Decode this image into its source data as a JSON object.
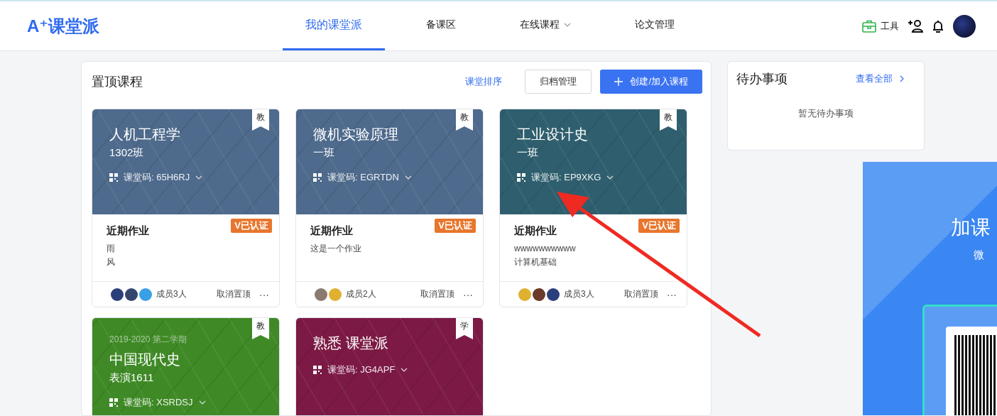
{
  "header": {
    "logo": "A⁺课堂派",
    "nav": [
      {
        "label": "我的课堂派",
        "selected": true,
        "dropdown": false
      },
      {
        "label": "备课区",
        "selected": false,
        "dropdown": false
      },
      {
        "label": "在线课程",
        "selected": false,
        "dropdown": true
      },
      {
        "label": "论文管理",
        "selected": false,
        "dropdown": false
      }
    ],
    "tools_label": "工具"
  },
  "pinned": {
    "title": "置顶课程",
    "sort_link": "课堂排序",
    "archive_button": "归档管理",
    "create_button": "创建/加入课程",
    "courses": [
      {
        "role": "教",
        "color": "#4e6a8c",
        "title": "人机工程学",
        "class": "1302班",
        "code": "课堂码: 65H6RJ",
        "certified": "V已认证",
        "homework_title": "近期作业",
        "homework": [
          "雨",
          "风"
        ],
        "members": "成员3人",
        "avatars": [
          {
            "color": "#2b3f7a"
          },
          {
            "color": "#34466e"
          },
          {
            "color": "#3aa0e6"
          }
        ],
        "unpin": "取消置顶",
        "more": "···"
      },
      {
        "role": "教",
        "color": "#4e6a8c",
        "title": "微机实验原理",
        "class": "一班",
        "code": "课堂码: EGRTDN",
        "certified": "V已认证",
        "homework_title": "近期作业",
        "homework": [
          "这是一个作业"
        ],
        "members": "成员2人",
        "avatars": [
          {
            "color": "#8a7a70"
          },
          {
            "color": "#e0b030"
          }
        ],
        "unpin": "取消置顶",
        "more": "···"
      },
      {
        "role": "教",
        "color": "#2f5f6e",
        "title": "工业设计史",
        "class": "一班",
        "code": "课堂码: EP9XKG",
        "certified": "V已认证",
        "homework_title": "近期作业",
        "homework": [
          "wwwwwwwwww",
          "计算机基础"
        ],
        "members": "成员3人",
        "avatars": [
          {
            "color": "#e0b030"
          },
          {
            "color": "#6b3a2a"
          },
          {
            "color": "#2b3f7a"
          }
        ],
        "unpin": "取消置顶",
        "more": "···"
      },
      {
        "role": "教",
        "color": "#3f8a26",
        "term": "2019-2020 第二学期",
        "title": "中国现代史",
        "class": "表演1611",
        "code": "课堂码: XSRDSJ"
      },
      {
        "role": "学",
        "color": "#7c1a45",
        "title": "熟悉 课堂派",
        "code": "课堂码: JG4APF"
      }
    ]
  },
  "todo": {
    "title": "待办事项",
    "view_all": "查看全部",
    "empty": "暂无待办事项"
  },
  "promo": {
    "title": "加课",
    "subtitle": "微"
  }
}
